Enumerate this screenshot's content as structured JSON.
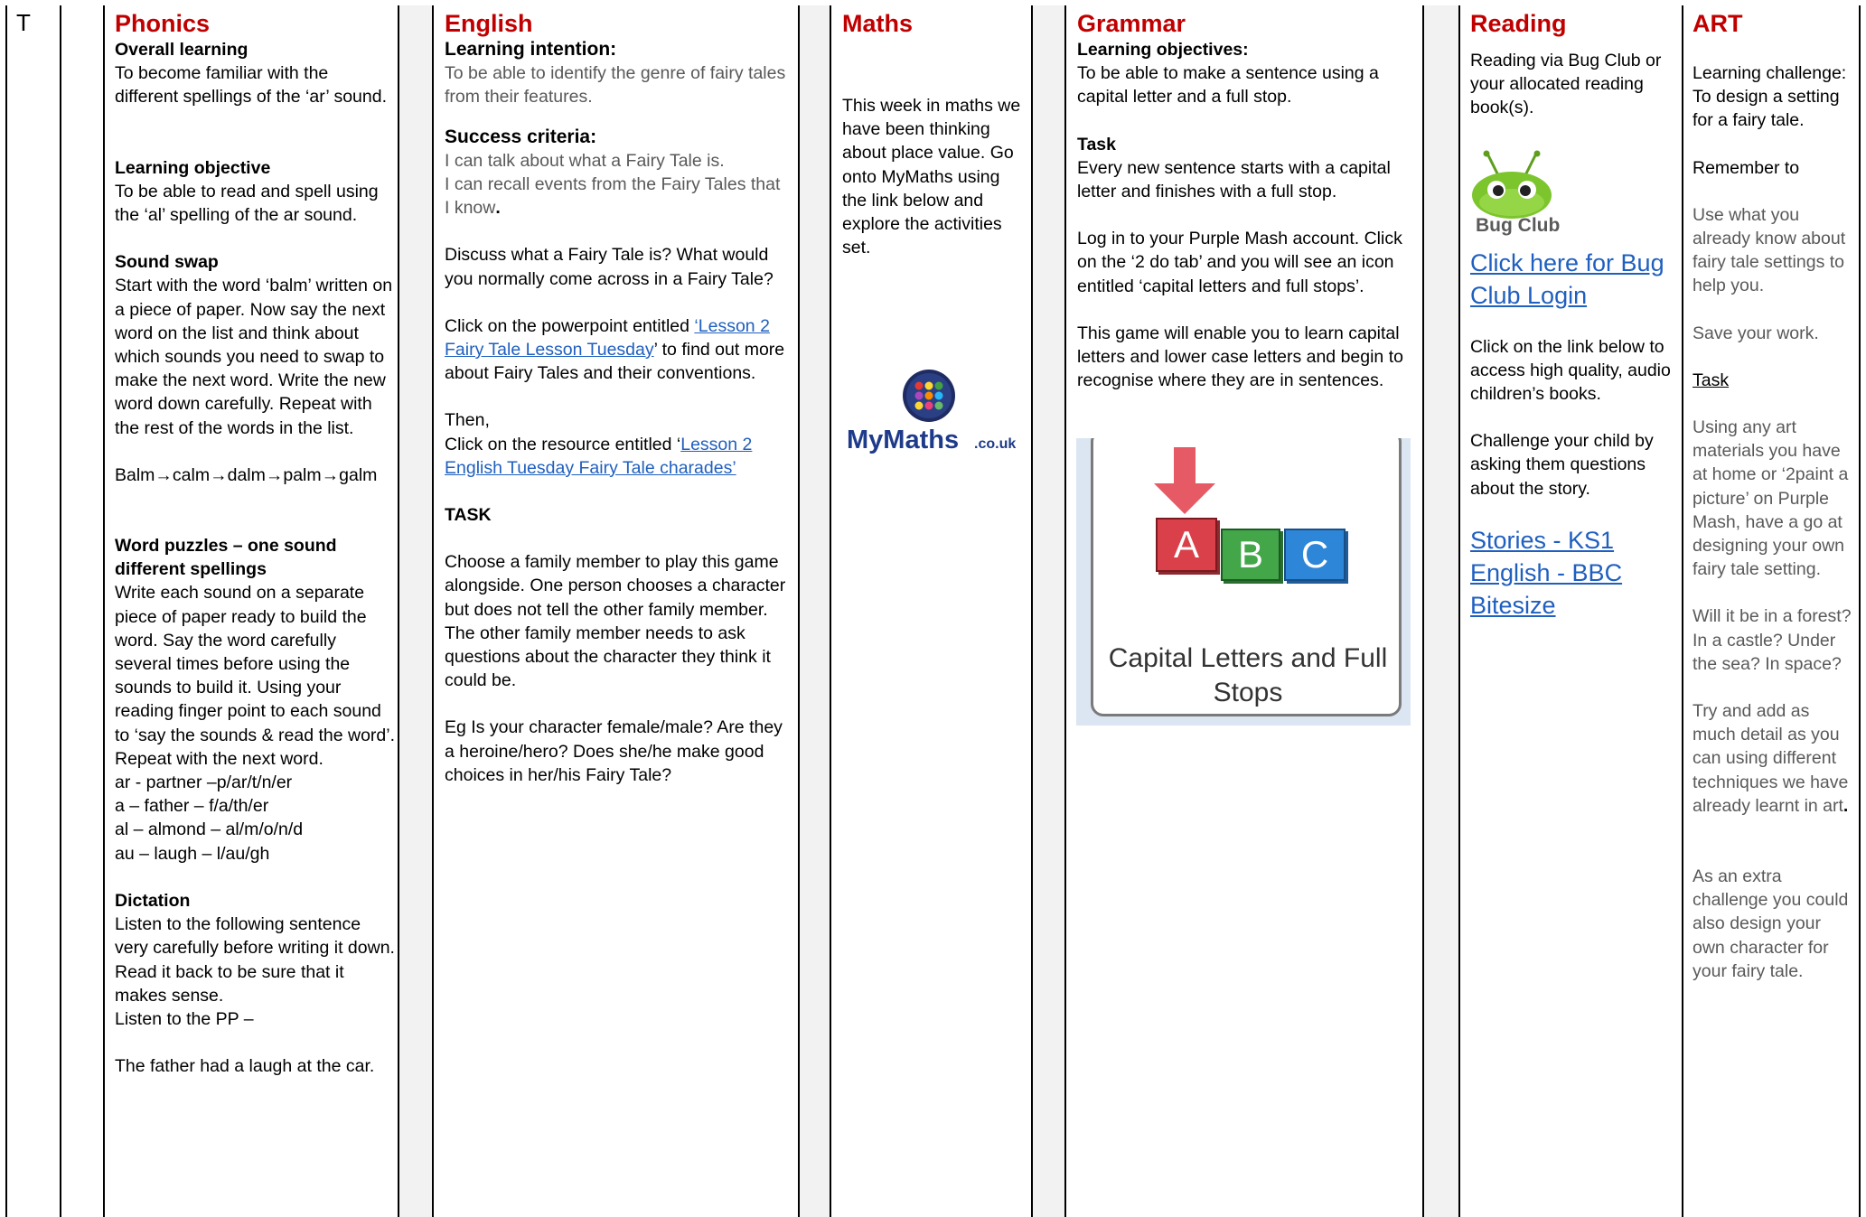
{
  "row_label": "T",
  "phonics": {
    "heading": "Phonics",
    "overall_title": "Overall learning",
    "overall_text": "To become familiar with the different spellings of the ‘ar’ sound.",
    "objective_title": "Learning objective",
    "objective_text": "To be able to read and spell using the ‘al’ spelling of the ar sound.",
    "swap_title": "Sound swap",
    "swap_text": "Start with the word ‘balm’ written on a piece of paper. Now say the next word on the list and think about which sounds you need to swap to make the next word. Write the new word down carefully. Repeat with the rest of the words in the list.",
    "chain": "Balm→calm→dalm→palm→galm",
    "puzzles_title": "Word puzzles – one sound different spellings",
    "puzzles_text": "Write each sound on a separate piece of paper ready to build the word. Say the word carefully several times before using the sounds to build it. Using your reading finger point to each sound to ‘say the sounds & read the word’. Repeat with the next word.",
    "spellings": [
      "ar - partner –p/ar/t/n/er",
      "a – father – f/a/th/er",
      "al – almond – al/m/o/n/d",
      "au – laugh – l/au/gh"
    ],
    "dictation_title": "Dictation",
    "dictation_text": "Listen to the following sentence very carefully before writing it down. Read it back to be sure that it makes sense.",
    "dictation_pp": "Listen to the PP –",
    "dictation_sentence": "The father had a laugh at the car."
  },
  "english": {
    "heading": "English",
    "intention_title": "Learning intention:",
    "intention_text": "To be able to identify the genre of fairy tales from their features.",
    "success_title": "Success criteria:",
    "success_1": "I can talk about what a Fairy Tale is.",
    "success_2": "I can recall events from the Fairy Tales that I know",
    "success_2_dot": ".",
    "discuss": "Discuss what a Fairy Tale is? What would you normally come across in a Fairy Tale?",
    "ppt_pre": "Click on the powerpoint entitled ",
    "ppt_q1": "‘",
    "ppt_link": "Lesson 2 Fairy Tale Lesson Tuesday",
    "ppt_post": "’ to find out more about Fairy Tales and their conventions.",
    "then": "Then,",
    "res_pre": "Click on the resource entitled ‘",
    "res_link": "Lesson 2 English Tuesday Fairy Tale charades’",
    "task_title": "TASK",
    "task_text": "Choose a family member to play this game alongside. One person chooses a character but does not tell the other family member. The other family member needs to ask questions about the character they think it could be.",
    "example": "Eg Is your character female/male? Are they a heroine/hero? Does she/he make good choices in her/his Fairy Tale?"
  },
  "maths": {
    "heading": "Maths",
    "text": "This week in maths we have been thinking about place value. Go onto MyMaths using the link below and explore the activities set.",
    "logo_main": "MyMaths",
    "logo_suffix": ".co.uk"
  },
  "grammar": {
    "heading": "Grammar",
    "objectives_title": "Learning objectives:",
    "objectives_text": " To be able to make a sentence using a capital letter and a full stop.",
    "task_title": "Task",
    "task_text": "Every new sentence starts with a capital letter and finishes with a full stop.",
    "login_text": "Log in to your Purple Mash account. Click on the ‘2 do tab’ and you will see an icon entitled ‘capital letters and full stops’.",
    "game_text": "This game will enable you to learn capital letters and lower case letters and begin to recognise where they are in sentences.",
    "tile_caption": "Capital Letters and Full Stops",
    "block_a": "A",
    "block_b": "B",
    "block_c": "C"
  },
  "reading": {
    "heading": "Reading",
    "intro": "Reading via Bug Club or your allocated reading book(s).",
    "logo_text": "Bug Club",
    "bugclub_link": "Click here for Bug Club Login",
    "link_text": "Click on the link below to access high quality, audio children’s books.",
    "challenge": "Challenge your child by asking them questions about the story.",
    "bbc_link": "Stories - KS1 English - BBC Bitesize"
  },
  "art": {
    "heading": "ART",
    "challenge_title": "Learning challenge:",
    "challenge_text": "To design a setting for a fairy tale.",
    "remember_title": "Remember to",
    "remember_text": "Use what you already know about fairy tale settings to help you.",
    "save": "Save your work.",
    "task_title": "Task",
    "task_text": "Using any art materials you have at home or ‘2paint a picture’ on Purple Mash, have a go at designing your own fairy tale setting.",
    "questions": "Will it be in a forest? In a castle? Under the sea? In space?",
    "detail": "Try and add as much detail as you can using different techniques we have already learnt in art",
    "detail_dot": ".",
    "extra": "As an extra challenge you could also design your own character for your fairy tale."
  },
  "colors": {
    "heading": "#c00000",
    "link": "#1f5fbf",
    "gap_column": "#f2f2f2",
    "light_text": "#595959"
  }
}
